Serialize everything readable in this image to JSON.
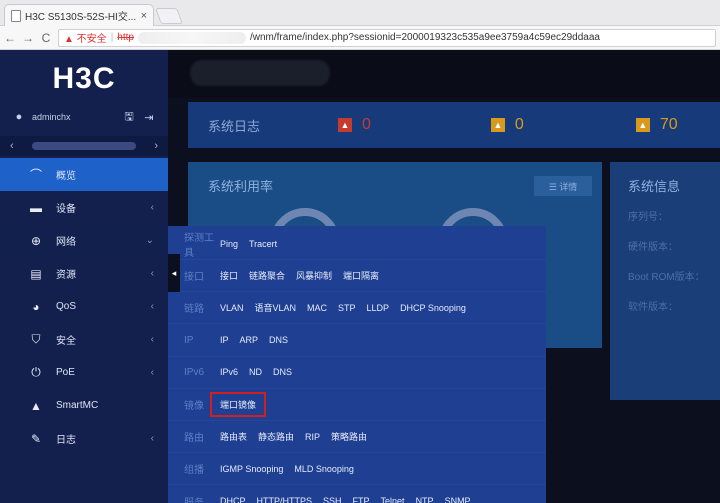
{
  "browser": {
    "tab_title": "H3C S5130S-52S-HI交...",
    "tab_close": "×",
    "back": "←",
    "forward": "→",
    "reload": "C",
    "insecure_label": "▲ 不安全",
    "separator": "|",
    "scheme": "http",
    "url_path": "/wnm/frame/index.php?sessionid=2000019323c535a9ee3759a4c59ec29ddaaa"
  },
  "sidebar": {
    "logo": "H3C",
    "username": "adminchx",
    "save_glyph": "🖫",
    "logout_glyph": "⇥",
    "prev": "‹",
    "next": "›",
    "items": [
      {
        "label": "概览",
        "icon": "dashboard-icon",
        "glyph": "⌒",
        "arrow": "",
        "state": "active"
      },
      {
        "label": "设备",
        "icon": "device-icon",
        "glyph": "▬",
        "arrow": "‹",
        "state": ""
      },
      {
        "label": "网络",
        "icon": "globe-icon",
        "glyph": "⊕",
        "arrow": "⌄",
        "state": "open"
      },
      {
        "label": "资源",
        "icon": "database-icon",
        "glyph": "▤",
        "arrow": "‹",
        "state": ""
      },
      {
        "label": "QoS",
        "icon": "qos-icon",
        "glyph": "◕",
        "arrow": "‹",
        "state": ""
      },
      {
        "label": "安全",
        "icon": "shield-icon",
        "glyph": "⛉",
        "arrow": "‹",
        "state": ""
      },
      {
        "label": "PoE",
        "icon": "poe-icon",
        "glyph": "⏻",
        "arrow": "‹",
        "state": ""
      },
      {
        "label": "SmartMC",
        "icon": "smartmc-icon",
        "glyph": "▲",
        "arrow": "",
        "state": ""
      },
      {
        "label": "日志",
        "icon": "log-icon",
        "glyph": "✎",
        "arrow": "‹",
        "state": ""
      }
    ]
  },
  "statbar": {
    "title": "系统日志",
    "alerts": [
      {
        "glyph": "▲",
        "value": "0",
        "color": "#c53b2e"
      },
      {
        "glyph": "▲",
        "value": "0",
        "color": "#d89a1d"
      },
      {
        "glyph": "▲",
        "value": "70",
        "color": "#d89a1d"
      }
    ]
  },
  "util_panel": {
    "title": "系统利用率",
    "detail_label": "☰ 详情"
  },
  "sys_panel": {
    "title": "系统信息",
    "rows": [
      "序列号：",
      "硬件版本：",
      "Boot ROM版本：",
      "软件版本："
    ]
  },
  "flyout": {
    "nub": "◂",
    "rows": [
      {
        "category": "探测工具",
        "links": [
          "Ping",
          "Tracert"
        ]
      },
      {
        "category": "接口",
        "links": [
          "接口",
          "链路聚合",
          "风暴抑制",
          "端口隔离"
        ]
      },
      {
        "category": "链路",
        "links": [
          "VLAN",
          "语音VLAN",
          "MAC",
          "STP",
          "LLDP",
          "DHCP Snooping"
        ]
      },
      {
        "category": "IP",
        "links": [
          "IP",
          "ARP",
          "DNS"
        ]
      },
      {
        "category": "IPv6",
        "links": [
          "IPv6",
          "ND",
          "DNS"
        ]
      },
      {
        "category": "镜像",
        "links": [
          "端口镜像"
        ],
        "highlight": "端口镜像"
      },
      {
        "category": "路由",
        "links": [
          "路由表",
          "静态路由",
          "RIP",
          "策略路由"
        ]
      },
      {
        "category": "组播",
        "links": [
          "IGMP Snooping",
          "MLD Snooping"
        ]
      },
      {
        "category": "服务",
        "links": [
          "DHCP",
          "HTTP/HTTPS",
          "SSH",
          "FTP",
          "Telnet",
          "NTP",
          "SNMP"
        ]
      }
    ]
  }
}
